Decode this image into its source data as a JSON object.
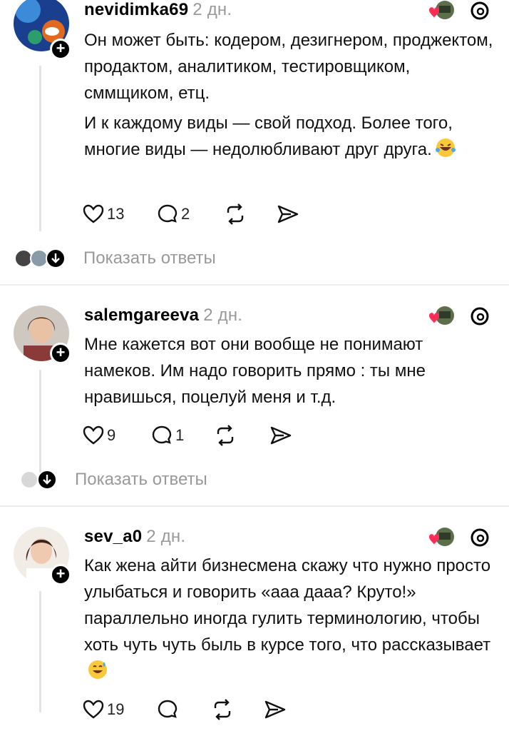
{
  "posts": [
    {
      "username": "nevidimka69",
      "time": "2 дн.",
      "paragraphs": [
        "Он может быть: кодером, дезигнером, проджектом, продактом, аналитиком, тестировщиком, сммщиком, етц.",
        "И к каждому виды — свой подход. Более того, многие виды — недолюбливают друг друга."
      ],
      "emoji": "laughing-emoji",
      "likes": "13",
      "comments": "2",
      "replies_label": "Показать ответы"
    },
    {
      "username": "salemgareeva",
      "time": "2 дн.",
      "paragraphs": [
        "Мне кажется вот они вообще не понимают намеков. Им надо говорить прямо : ты мне нравишься, поцелуй меня и т.д."
      ],
      "likes": "9",
      "comments": "1",
      "replies_label": "Показать ответы"
    },
    {
      "username": "sev_a0",
      "time": "2 дн.",
      "paragraphs": [
        "Как жена айти бизнесмена скажу что нужно просто улыбаться и говорить «ааа дааа? Круто!» параллельно иногда гулить терминологию, чтобы хоть чуть чуть быль в курсе того, что рассказывает"
      ],
      "emoji": "sweat-smile-emoji",
      "likes": "19"
    }
  ],
  "colors": {
    "accent_heart": "#ff2d55",
    "muted_text": "#999999",
    "divider": "#ededed"
  }
}
